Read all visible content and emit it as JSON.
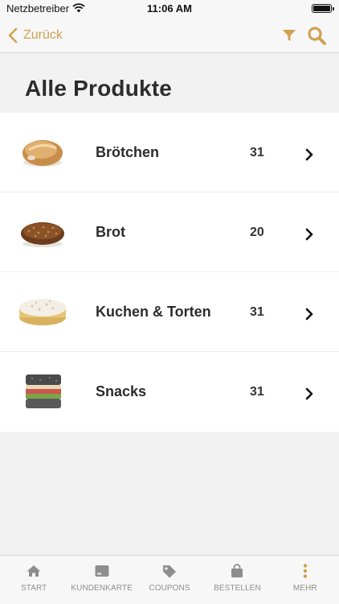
{
  "status_bar": {
    "carrier": "Netzbetreiber",
    "time": "11:06 AM"
  },
  "nav": {
    "back_label": "Zurück",
    "accent_color": "#d2a04f"
  },
  "page": {
    "title": "Alle Produkte"
  },
  "products": [
    {
      "name": "Brötchen",
      "count": "31",
      "image": "bread-roll-image"
    },
    {
      "name": "Brot",
      "count": "20",
      "image": "bread-loaf-image"
    },
    {
      "name": "Kuchen & Torten",
      "count": "31",
      "image": "cake-image"
    },
    {
      "name": "Snacks",
      "count": "31",
      "image": "sandwich-image"
    }
  ],
  "tab_bar": {
    "tabs": [
      {
        "label": "START",
        "icon": "home-icon"
      },
      {
        "label": "KUNDENKARTE",
        "icon": "card-icon"
      },
      {
        "label": "COUPONS",
        "icon": "tag-icon"
      },
      {
        "label": "BESTELLEN",
        "icon": "bag-icon"
      },
      {
        "label": "MEHR",
        "icon": "more-icon"
      }
    ]
  }
}
